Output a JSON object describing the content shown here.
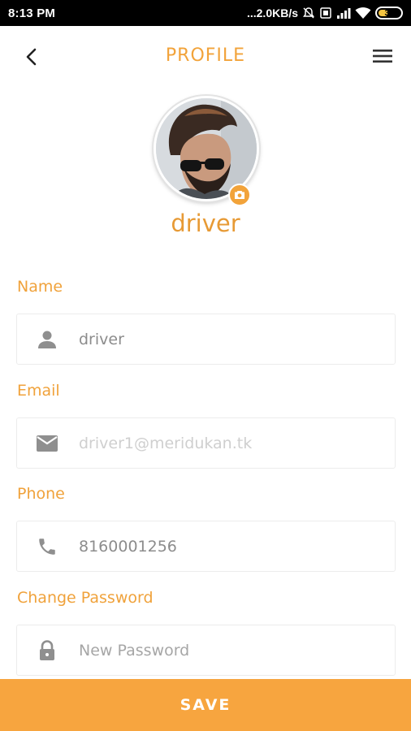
{
  "status_bar": {
    "time": "8:13 PM",
    "network_speed": "...2.0KB/s",
    "battery_level": "33",
    "icons": [
      "mute-alarm-icon",
      "sim-icon",
      "signal-icon",
      "wifi-icon",
      "battery-icon"
    ]
  },
  "header": {
    "title": "PROFILE",
    "back_icon": "chevron-left-icon",
    "menu_icon": "hamburger-menu-icon"
  },
  "profile": {
    "display_name": "driver",
    "camera_icon": "camera-icon"
  },
  "form": {
    "name": {
      "label": "Name",
      "value": "driver",
      "icon": "person-icon"
    },
    "email": {
      "label": "Email",
      "value": "driver1@meridukan.tk",
      "icon": "mail-icon"
    },
    "phone": {
      "label": "Phone",
      "value": "8160001256",
      "icon": "phone-icon"
    },
    "password": {
      "label": "Change Password",
      "placeholder": "New Password",
      "icon": "lock-icon"
    }
  },
  "actions": {
    "save_label": "SAVE"
  },
  "colors": {
    "accent": "#f2a33a",
    "save_bar": "#f7a53f",
    "status_bar": "#000000",
    "field_border": "#ececec",
    "icon_gray": "#8f8f8f"
  }
}
